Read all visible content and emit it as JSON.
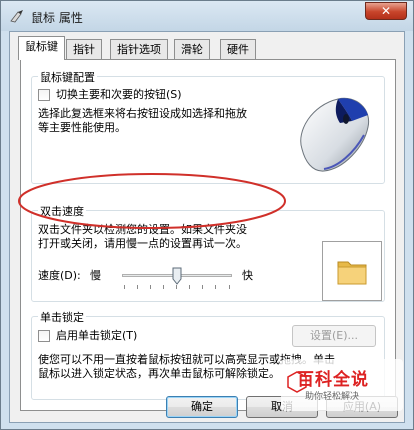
{
  "window": {
    "title": "鼠标 属性",
    "close_glyph": "✕"
  },
  "tabs": [
    {
      "label": "鼠标键",
      "active": true
    },
    {
      "label": "指针",
      "active": false
    },
    {
      "label": "指针选项",
      "active": false
    },
    {
      "label": "滑轮",
      "active": false
    },
    {
      "label": "硬件",
      "active": false
    }
  ],
  "button_config": {
    "title": "鼠标键配置",
    "checkbox_label": "切换主要和次要的按钮(S)",
    "checked": false,
    "description_line1": "选择此复选框来将右按钮设成如选择和拖放",
    "description_line2": "等主要性能使用。"
  },
  "double_click": {
    "title": "双击速度",
    "description_line1": "双击文件夹以检测您的设置。如果文件夹没",
    "description_line2": "打开或关闭，请用慢一点的设置再试一次。",
    "speed_label": "速度(D):",
    "slow_label": "慢",
    "fast_label": "快",
    "speed_level": 0.5
  },
  "click_lock": {
    "title": "单击锁定",
    "checkbox_label": "启用单击锁定(T)",
    "checked": false,
    "settings_button": "设置(E)...",
    "description_line1": "使您可以不用一直按着鼠标按钮就可以高亮显示或拖拽。单击",
    "description_line2": "鼠标以进入锁定状态，再次单击鼠标可解除锁定。"
  },
  "footer": {
    "ok": "确定",
    "cancel": "取消",
    "apply": "应用(A)"
  },
  "watermark": {
    "main": "百科全说",
    "sub": "助你轻松解决"
  },
  "colors": {
    "annotation_circle": "#d0302a",
    "watermark_text": "#dd2222"
  }
}
